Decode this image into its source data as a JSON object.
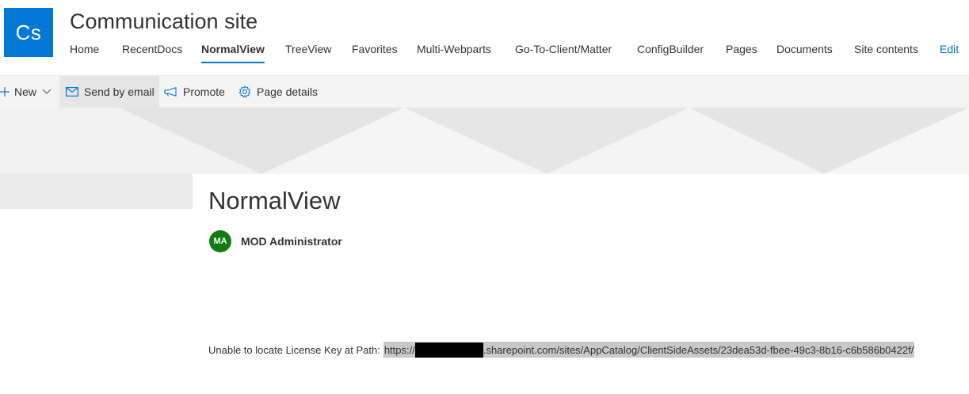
{
  "site": {
    "logo_text": "Cs",
    "title": "Communication site"
  },
  "nav": {
    "items": [
      {
        "label": "Home"
      },
      {
        "label": "RecentDocs"
      },
      {
        "label": "NormalView",
        "active": true
      },
      {
        "label": "TreeView"
      },
      {
        "label": "Favorites"
      },
      {
        "label": "Multi-Webparts"
      },
      {
        "label": "Go-To-Client/Matter"
      },
      {
        "label": "ConfigBuilder"
      },
      {
        "label": "Pages"
      },
      {
        "label": "Documents"
      },
      {
        "label": "Site contents"
      }
    ],
    "edit_label": "Edit"
  },
  "commands": {
    "new_label": "New",
    "send_label": "Send by email",
    "promote_label": "Promote",
    "details_label": "Page details"
  },
  "page": {
    "title": "NormalView",
    "author_initials": "MA",
    "author_name": "MOD Administrator"
  },
  "license": {
    "message": "Unable to locate License Key at Path:",
    "path_prefix": "https://",
    "path_suffix": ".sharepoint.com/sites/AppCatalog/ClientSideAssets/23dea53d-fbee-49c3-8b16-c6b586b0422f/"
  },
  "colors": {
    "accent": "#0078d4",
    "avatar": "#107c10",
    "logo_bg": "#0078d4"
  },
  "icons": {
    "new": "plus-icon",
    "new_menu": "chevron-down-icon",
    "send": "mail-icon",
    "promote": "megaphone-icon",
    "details": "gear-icon"
  }
}
